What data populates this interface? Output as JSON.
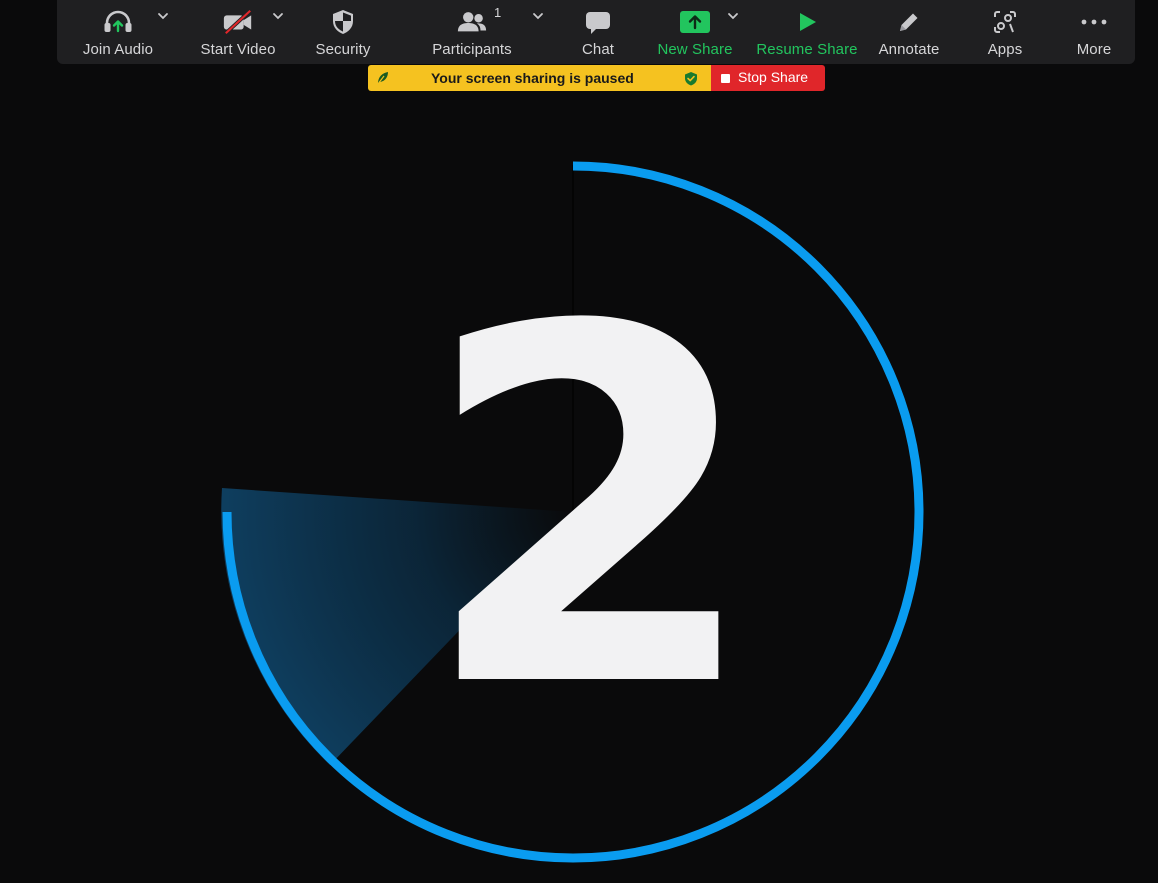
{
  "toolbar": {
    "buttons": [
      {
        "label": "Join Audio",
        "icon": "headphones-upload-icon",
        "has_caret": true
      },
      {
        "label": "Start Video",
        "icon": "video-off-icon",
        "has_caret": true
      },
      {
        "label": "Security",
        "icon": "shield-icon",
        "has_caret": false
      },
      {
        "label": "Participants",
        "icon": "participants-icon",
        "has_caret": true,
        "count": "1"
      },
      {
        "label": "Chat",
        "icon": "chat-bubble-icon",
        "has_caret": false
      },
      {
        "label": "New Share",
        "icon": "share-upload-icon",
        "has_caret": true,
        "highlight": "green"
      },
      {
        "label": "Resume Share",
        "icon": "play-icon",
        "has_caret": false,
        "highlight": "green"
      },
      {
        "label": "Annotate",
        "icon": "pencil-icon",
        "has_caret": false
      },
      {
        "label": "Apps",
        "icon": "apps-icon",
        "has_caret": false
      },
      {
        "label": "More",
        "icon": "more-dots-icon",
        "has_caret": false
      }
    ]
  },
  "banner": {
    "message": "Your screen sharing is paused",
    "stop_label": "Stop Share"
  },
  "countdown": {
    "digit": "2"
  },
  "colors": {
    "toolbar_bg": "#1f1f21",
    "green": "#22c55e",
    "banner_yellow": "#f5c220",
    "stop_red": "#e0262a",
    "ring_blue": "#0a9cf0",
    "background": "#0a0a0b"
  }
}
